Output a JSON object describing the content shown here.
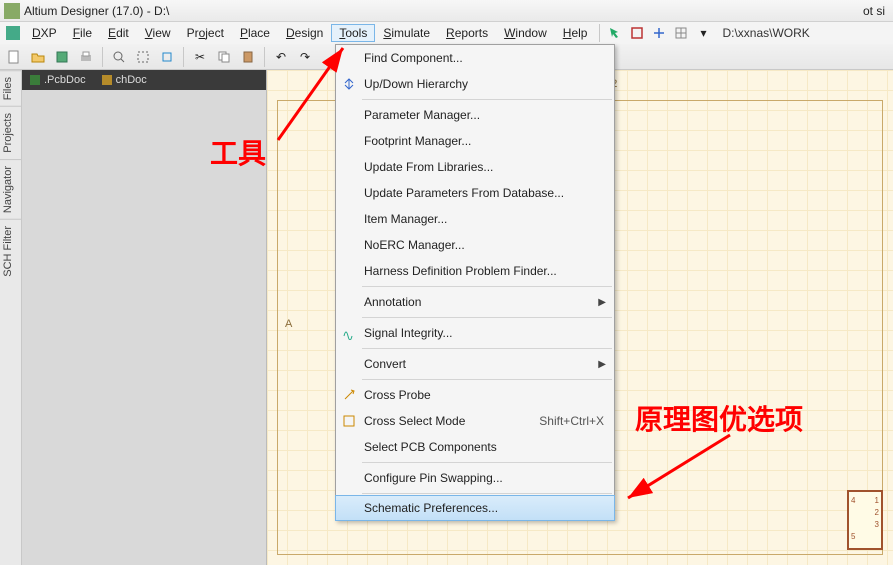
{
  "title": "Altium Designer (17.0) - D:\\",
  "title_suffix": "ot si",
  "menus": {
    "dxp": "DXP",
    "file": "File",
    "edit": "Edit",
    "view": "View",
    "project": "Project",
    "place": "Place",
    "design": "Design",
    "tools": "Tools",
    "simulate": "Simulate",
    "reports": "Reports",
    "window": "Window",
    "help": "Help"
  },
  "path_field": "D:\\xxnas\\WORK",
  "sidetabs": {
    "files": "Files",
    "projects": "Projects",
    "navigator": "Navigator",
    "schfilter": "SCH Filter"
  },
  "doc_tabs": {
    "pcb": ".PcbDoc",
    "sch": "chDoc"
  },
  "tools_menu": {
    "find_component": "Find Component...",
    "updown": "Up/Down Hierarchy",
    "param_mgr": "Parameter Manager...",
    "footprint_mgr": "Footprint Manager...",
    "update_libs": "Update From Libraries...",
    "update_db": "Update Parameters From Database...",
    "item_mgr": "Item Manager...",
    "noerc": "NoERC Manager...",
    "harness": "Harness Definition Problem Finder...",
    "annotation": "Annotation",
    "signal": "Signal Integrity...",
    "convert": "Convert",
    "cross_probe": "Cross Probe",
    "cross_select": "Cross Select Mode",
    "cross_select_shortcut": "Shift+Ctrl+X",
    "select_pcb": "Select PCB Components",
    "config_swap": "Configure Pin Swapping...",
    "sch_pref": "Schematic Preferences..."
  },
  "ruler_num": "2",
  "ruler_a": "A",
  "annotation_tools": "工具",
  "annotation_pref": "原理图优选项",
  "chip": {
    "p1": "1",
    "p2": "2",
    "p3": "3",
    "p4": "4",
    "p5": "5"
  }
}
